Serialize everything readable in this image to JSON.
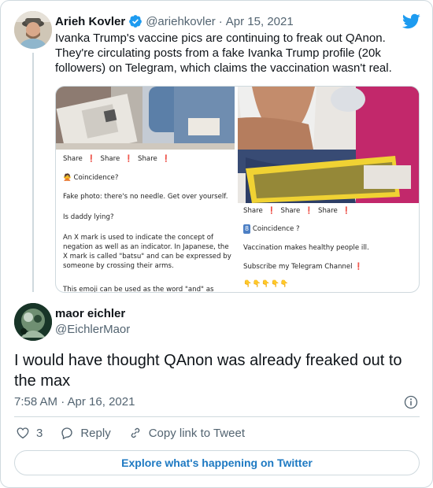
{
  "parent": {
    "name": "Arieh Kovler",
    "handle": "@ariehkovler",
    "separator": "·",
    "date": "Apr 15, 2021",
    "text": "Ivanka Trump's vaccine pics are continuing to freak out QAnon. They're circulating posts from a fake Ivanka Trump profile (20k followers) on Telegram, which claims the vaccination wasn't real.",
    "media_left": {
      "share_row": [
        "Share",
        "Share",
        "Share"
      ],
      "coincidence": "Coincidence?",
      "lines": [
        "Fake photo: there's no needle. Get over yourself.",
        "Is daddy lying?",
        "An X mark is used to indicate the concept of negation as well as an indicator. In Japanese, the X mark is called \"batsu\" and can be expressed by someone by crossing their arms.",
        "This emoji can be used as the word \"and\" as well."
      ]
    },
    "media_right": {
      "share_row": [
        "Share",
        "Share",
        "Share"
      ],
      "coincidence": "Coincidence ?",
      "line1": "Vaccination makes healthy people ill.",
      "line2": "Subscribe my Telegram Channel",
      "hands": "👇👇👇👇👇"
    }
  },
  "reply": {
    "name": "maor eichler",
    "handle": "@EichlerMaor",
    "text": "I would have thought QAnon was already freaked out to the max",
    "timestamp": "7:58 AM · Apr 16, 2021",
    "likes": "3",
    "reply_label": "Reply",
    "copy_label": "Copy link to Tweet"
  },
  "explore_label": "Explore what's happening on Twitter",
  "colors": {
    "brand": "#1d9bf0",
    "link": "#1d79c2",
    "muted": "#536471",
    "border": "#cfd9de",
    "alert": "#d72b2b"
  },
  "icons": [
    "verified-badge-icon",
    "twitter-bird-icon",
    "info-icon",
    "heart-icon",
    "reply-bubble-icon",
    "link-icon"
  ]
}
